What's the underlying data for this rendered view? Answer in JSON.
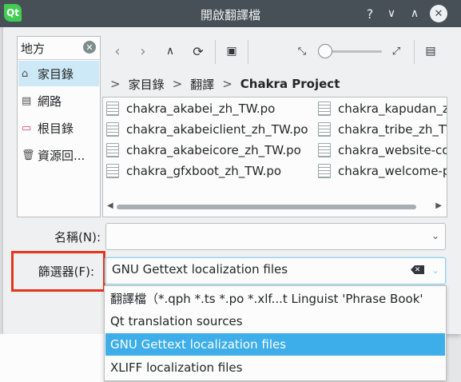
{
  "window": {
    "title": "開啟翻譯檔",
    "app_icon_text": "Qt",
    "buttons": {
      "help": "?",
      "minimize": "∨",
      "maximize": "∧",
      "close": "✕"
    }
  },
  "places": {
    "header": "地方",
    "items": [
      {
        "label": "家目錄",
        "icon": "home-icon",
        "selected": true
      },
      {
        "label": "網路",
        "icon": "network-icon",
        "selected": false
      },
      {
        "label": "根目錄",
        "icon": "root-folder-icon",
        "selected": false
      },
      {
        "label": "資源回...",
        "icon": "trash-icon",
        "selected": false
      }
    ]
  },
  "breadcrumb": {
    "segments": [
      "家目錄",
      "翻譯",
      "Chakra Project"
    ],
    "separator": ">"
  },
  "files": [
    "chakra_akabei_zh_TW.po",
    "chakra_akabeiclient_zh_TW.po",
    "chakra_akabeicore_zh_TW.po",
    "chakra_gfxboot_zh_TW.po",
    "chakra_kapudan_zh",
    "chakra_tribe_zh_T\\",
    "chakra_website-co",
    "chakra_welcome-p"
  ],
  "form": {
    "name_label": "名稱(N):",
    "name_value": "",
    "filter_label": "篩選器(F):",
    "filter_value": "GNU Gettext localization files"
  },
  "filter_options": [
    {
      "label": "翻譯檔（*.qph *.ts *.po *.xlf...t Linguist 'Phrase Book'",
      "selected": false
    },
    {
      "label": "Qt translation sources",
      "selected": false
    },
    {
      "label": "GNU Gettext localization files",
      "selected": true
    },
    {
      "label": "XLIFF localization files",
      "selected": false
    }
  ],
  "colors": {
    "titlebar": "#475057",
    "selection": "#3daee9",
    "highlight_box": "#e8341c"
  }
}
